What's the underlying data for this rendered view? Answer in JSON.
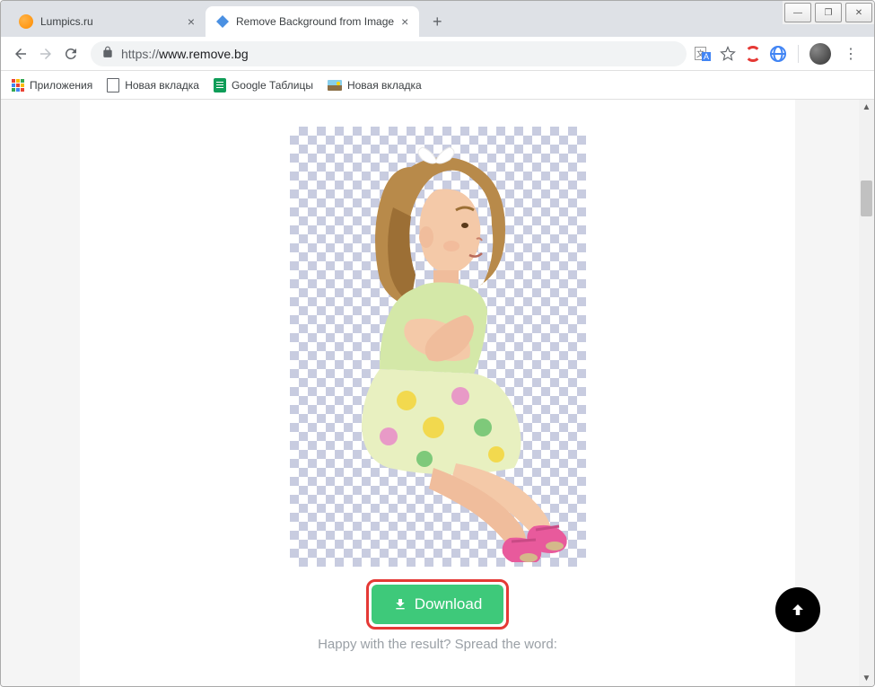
{
  "window": {
    "controls": {
      "minimize": "—",
      "maximize": "❐",
      "close": "✕"
    }
  },
  "tabs": [
    {
      "title": "Lumpics.ru",
      "active": false
    },
    {
      "title": "Remove Background from Image",
      "active": true
    }
  ],
  "toolbar": {
    "url_scheme": "https://",
    "url_rest": "www.remove.bg"
  },
  "bookmarks": {
    "apps": "Приложения",
    "items": [
      {
        "label": "Новая вкладка",
        "icon": "file"
      },
      {
        "label": "Google Таблицы",
        "icon": "sheets"
      },
      {
        "label": "Новая вкладка",
        "icon": "picture"
      }
    ]
  },
  "page": {
    "download_label": "Download",
    "share_text": "Happy with the result? Spread the word:"
  },
  "colors": {
    "download_bg": "#3ec97a",
    "highlight": "#e53935"
  }
}
